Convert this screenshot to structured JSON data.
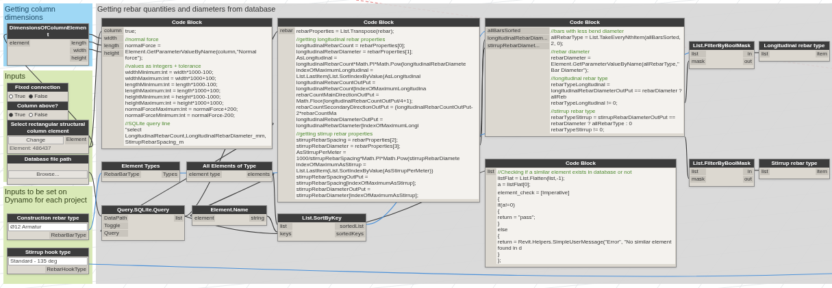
{
  "groups": [
    {
      "title": "Getting column dimensions",
      "kind": "blue"
    },
    {
      "title": "Inputs",
      "kind": "green"
    },
    {
      "title": "Inputs to be set on Dynamo for each project",
      "kind": "green"
    },
    {
      "title": "Getting rebar quantities and diameters from database",
      "kind": "grey"
    }
  ],
  "nodes": [
    {
      "kind": "node",
      "title": "DimensionsOfColumnElement",
      "inputs": [
        "element"
      ],
      "outputs": [
        "length",
        "width",
        "height"
      ]
    },
    {
      "kind": "boolean",
      "title": "Fixed connection",
      "options": [
        {
          "label": "True",
          "selected": false
        },
        {
          "label": "False",
          "selected": true
        }
      ]
    },
    {
      "kind": "boolean",
      "title": "Column above?",
      "options": [
        {
          "label": "True",
          "selected": true
        },
        {
          "label": "False",
          "selected": false
        }
      ]
    },
    {
      "kind": "select",
      "title": "Select rectangular structural column element",
      "button": "Change",
      "output": "Element",
      "value": "Element: 486437"
    },
    {
      "kind": "path",
      "title": "Database file path",
      "button": "Browse..."
    },
    {
      "kind": "dropdown",
      "title": "Construction rebar type",
      "value": "Ø12 Armatur",
      "output": "RebarBarType"
    },
    {
      "kind": "dropdown",
      "title": "Stirrup hook type",
      "value": "Standard - 135 deg",
      "output": "RebarHookType"
    },
    {
      "kind": "code",
      "title": "Code Block",
      "inputs": [
        "column",
        "width",
        "length",
        "height"
      ],
      "code": [
        [
          {
            "kind": "code",
            "text": "true;"
          }
        ],
        [
          {
            "kind": "comment",
            "text": "//normal force"
          },
          {
            "kind": "code",
            "text": "normalForce = Element.GetParameterValueByName(column,\"Normal force\");"
          }
        ],
        [
          {
            "kind": "comment",
            "text": "//values as integers + tolerance"
          },
          {
            "kind": "code",
            "text": "widthMinimum:int = width*1000-100;"
          },
          {
            "kind": "code",
            "text": "widthMaximum:int = width*1000+100;"
          },
          {
            "kind": "code",
            "text": "lengthMinimum:int = length*1000-100;"
          },
          {
            "kind": "code",
            "text": "lengthMaximum:int = length*1000+100;"
          },
          {
            "kind": "code",
            "text": "heightMinimum:int = height*1000-1000;"
          },
          {
            "kind": "code",
            "text": "heightMaximum:int = height*1000+1000;"
          },
          {
            "kind": "code",
            "text": "normalForceMaximum:int = normalForce+200;"
          },
          {
            "kind": "code",
            "text": "normalForceMinimum:int = normalForce-200;"
          }
        ],
        [
          {
            "kind": "comment",
            "text": "//SQLite query line"
          },
          {
            "kind": "code",
            "text": "\"select LongitudinalRebarCount,LongitudinalRebarDiameter_mm,StirrupRebarSpacing_m"
          }
        ]
      ]
    },
    {
      "kind": "node",
      "title": "Element Types",
      "inputs": [
        "RebarBarType"
      ],
      "outputs": [
        "Types"
      ]
    },
    {
      "kind": "node",
      "title": "All Elements of Type",
      "inputs": [
        "element type"
      ],
      "outputs": [
        "elements"
      ]
    },
    {
      "kind": "node",
      "title": "Query.SQLite.Query",
      "inputs": [
        "DataPath",
        "Toggle",
        "Query"
      ],
      "outputs": [
        "list"
      ]
    },
    {
      "kind": "node",
      "title": "Element.Name",
      "inputs": [
        "element"
      ],
      "outputs": [
        "string"
      ]
    },
    {
      "kind": "code",
      "title": "Code Block",
      "inputs": [
        "rebar"
      ],
      "code": [
        [
          {
            "kind": "code",
            "text": "rebarProperties = List.Transpose(rebar);"
          }
        ],
        [
          {
            "kind": "comment",
            "text": "//getting longitudinal rebar properties"
          },
          {
            "kind": "code",
            "text": "longitudinalRebarCount = rebarProperties[0];"
          },
          {
            "kind": "code",
            "text": "longitudinalRebarDiameter = rebarProperties[1];"
          },
          {
            "kind": "code",
            "text": "AsLongitudinal = longitudinalRebarCount*Math.PI*Math.Pow(longitudinalRebarDiamete"
          },
          {
            "kind": "code",
            "text": "indexOfMaximumLongitudinal = List.LastItem(List.SortIndexByValue(AsLongitudinal"
          },
          {
            "kind": "code",
            "text": "longitudinalRebarCountOutPut = longitudinalRebarCount[indexOfMaximumLongitudina"
          },
          {
            "kind": "code",
            "text": "rebarCountMainDirectionOutPut = Math.Floor(longitudinalRebarCountOutPut/4+1);"
          },
          {
            "kind": "code",
            "text": "rebarCountSecondaryDirectionOutPut = (longitudinalRebarCountOutPut-2*rebarCountMa"
          },
          {
            "kind": "code",
            "text": "longitudinalRebarDiameterOutPut = longitudinalRebarDiameter[indexOfMaximumLongi"
          }
        ],
        [
          {
            "kind": "comment",
            "text": "//getting stirrup rebar properties"
          },
          {
            "kind": "code",
            "text": "stirrupRebarSpacing = rebarProperties[2];"
          },
          {
            "kind": "code",
            "text": "stirrupRebarDiameter = rebarProperties[3];"
          },
          {
            "kind": "code",
            "text": "AsStirrupPerMeter = 1000/stirrupRebarSpacing*Math.PI*Math.Pow(stirrupRebarDiamete"
          },
          {
            "kind": "code",
            "text": "indexOfMaximumAsStirrup = List.LastItem(List.SortIndexByValue(AsStirrupPerMeter))"
          },
          {
            "kind": "code",
            "text": "stirrupRebarSpacingOutPut = stirrupRebarSpacing[indexOfMaximumAsStirrup];"
          },
          {
            "kind": "code",
            "text": "stirrupRebarDiameterOutPut = stirrupRebarDiameter[indexOfMaximumAsStirrup];"
          }
        ]
      ]
    },
    {
      "kind": "node",
      "title": "List.SortByKey",
      "inputs": [
        "list",
        "keys"
      ],
      "outputs": [
        "sortedList",
        "sortedKeys"
      ]
    },
    {
      "kind": "code",
      "title": "Code Block",
      "inputs": [
        "allBarsSorted",
        "longitudinalRebarDiam...",
        "stirrupRebarDiamet..."
      ],
      "code": [
        [
          {
            "kind": "comment",
            "text": "//bars with less bend diameter"
          },
          {
            "kind": "code",
            "text": "allRebarType = List.TakeEveryNthItem(allBarsSorted, 2, 0);"
          }
        ],
        [
          {
            "kind": "comment",
            "text": "//rebar diameter"
          },
          {
            "kind": "code",
            "text": "rebarDiameter = Element.GetParameterValueByName(allRebarType,\"Bar Diameter\");"
          }
        ],
        [
          {
            "kind": "comment",
            "text": "//longitudinal rebar type"
          },
          {
            "kind": "code",
            "text": "rebarTypeLongitudinal = longitudinalRebarDiameterOutPut == rebarDiameter ? allReb"
          },
          {
            "kind": "code",
            "text": "rebarTypeLongitudinal != 0;"
          }
        ],
        [
          {
            "kind": "comment",
            "text": "//stirrup rebar type"
          },
          {
            "kind": "code",
            "text": "rebarTypeStirrup = stirrupRebarDiameterOutPut == rebarDiameter ? allRebarType : 0"
          },
          {
            "kind": "code",
            "text": "rebarTypeStirrup != 0;"
          }
        ]
      ]
    },
    {
      "kind": "code",
      "title": "Code Block",
      "inputs": [
        "list"
      ],
      "code": [
        [
          {
            "kind": "comment",
            "text": "//Checking if a similar element exists in database or not"
          },
          {
            "kind": "code",
            "text": "listFlat = List.Flatten(list,-1);"
          },
          {
            "kind": "code",
            "text": "a = listFlat[0];"
          }
        ],
        [
          {
            "kind": "code",
            "text": "element_check = [Imperative]"
          },
          {
            "kind": "code",
            "text": "{"
          },
          {
            "kind": "code",
            "text": "if(a!=0)"
          },
          {
            "kind": "code",
            "text": "{"
          },
          {
            "kind": "code",
            "text": "return = \"pass\";"
          },
          {
            "kind": "code",
            "text": "}"
          },
          {
            "kind": "code",
            "text": "else"
          },
          {
            "kind": "code",
            "text": "{"
          },
          {
            "kind": "code",
            "text": "return = Revit.Helpers.SimpleUserMessage(\"Error\", \"No similar element found in d"
          },
          {
            "kind": "code",
            "text": "}"
          },
          {
            "kind": "code",
            "text": "};"
          }
        ]
      ]
    },
    {
      "kind": "node",
      "title": "List.FilterByBoolMask",
      "inputs": [
        "list",
        "mask"
      ],
      "outputs": [
        "in",
        "out"
      ]
    },
    {
      "kind": "node",
      "title": "Longitudinal rebar type",
      "inputs": [
        "list"
      ],
      "outputs": [
        "item"
      ]
    },
    {
      "kind": "node",
      "title": "List.FilterByBoolMask",
      "inputs": [
        "list",
        "mask"
      ],
      "outputs": [
        "in",
        "out"
      ]
    },
    {
      "kind": "node",
      "title": "Stirrup rebar type",
      "inputs": [
        "list"
      ],
      "outputs": [
        "item"
      ]
    }
  ]
}
